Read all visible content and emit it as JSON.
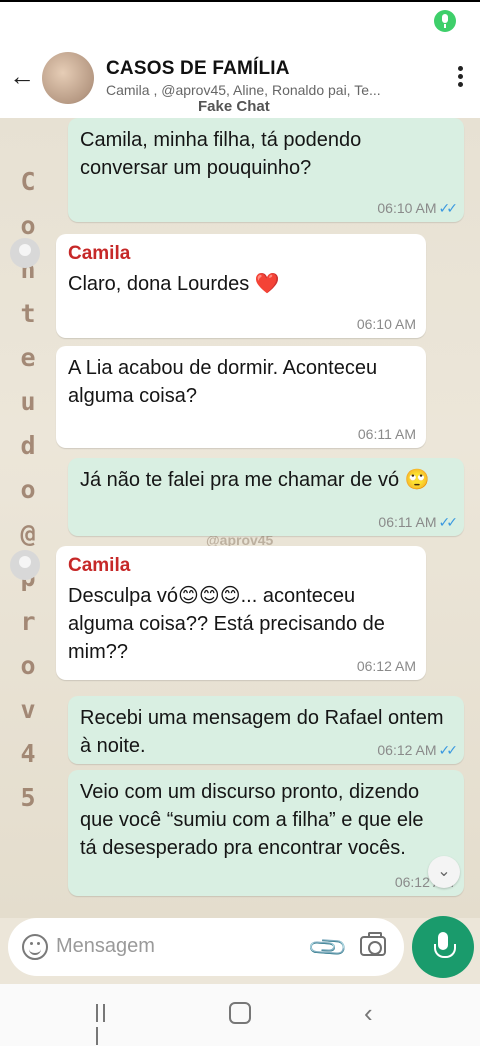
{
  "header": {
    "title": "CASOS DE FAMÍLIA",
    "subtitle": "Camila , @aprov45, Aline, Ronaldo pai, Te...",
    "label": "Fake Chat"
  },
  "watermark": {
    "letters": [
      "C",
      "o",
      "n",
      "t",
      "e",
      "u",
      "d",
      "o",
      "@",
      "p",
      "r",
      "o",
      "v",
      "4",
      "5"
    ],
    "center_text": "@aprov45"
  },
  "messages": [
    {
      "direction": "out",
      "text": "Camila, minha filha, tá podendo conversar um pouquinho?",
      "time": "06:10 AM",
      "ticks": "✓✓"
    },
    {
      "direction": "in",
      "sender": "Camila",
      "text": "Claro, dona Lourdes ❤️",
      "time": "06:10 AM"
    },
    {
      "direction": "in",
      "text": "A Lia acabou de dormir. Aconteceu alguma coisa?",
      "time": "06:11 AM"
    },
    {
      "direction": "out",
      "text": "Já não te falei pra me chamar de vó 🙄",
      "time": "06:11 AM",
      "ticks": "✓✓"
    },
    {
      "direction": "in",
      "sender": "Camila",
      "text": "Desculpa vó😊😊😊... aconteceu alguma coisa?? Está precisando de mim??",
      "time": "06:12 AM"
    },
    {
      "direction": "out",
      "text": "Recebi uma mensagem do Rafael ontem à noite.",
      "time": "06:12 AM",
      "ticks": "✓✓"
    },
    {
      "direction": "out",
      "text": "Veio com um discurso pronto, dizendo que você “sumiu com a filha” e que ele tá desesperado pra encontrar vocês.",
      "time": "06:12 AM"
    }
  ],
  "composer": {
    "placeholder": "Mensagem"
  },
  "icons": {
    "back": "arrow-left-icon",
    "menu": "kebab-menu-icon",
    "emoji": "emoji-icon",
    "attach": "paperclip-icon",
    "camera": "camera-icon",
    "mic": "microphone-icon",
    "scroll": "chevron-double-down-icon"
  },
  "colors": {
    "outgoing_bubble": "#d9efe2",
    "incoming_bubble": "#ffffff",
    "sender_name": "#c62828",
    "read_ticks": "#3b99e0",
    "mic_button": "#1a9b6c"
  }
}
